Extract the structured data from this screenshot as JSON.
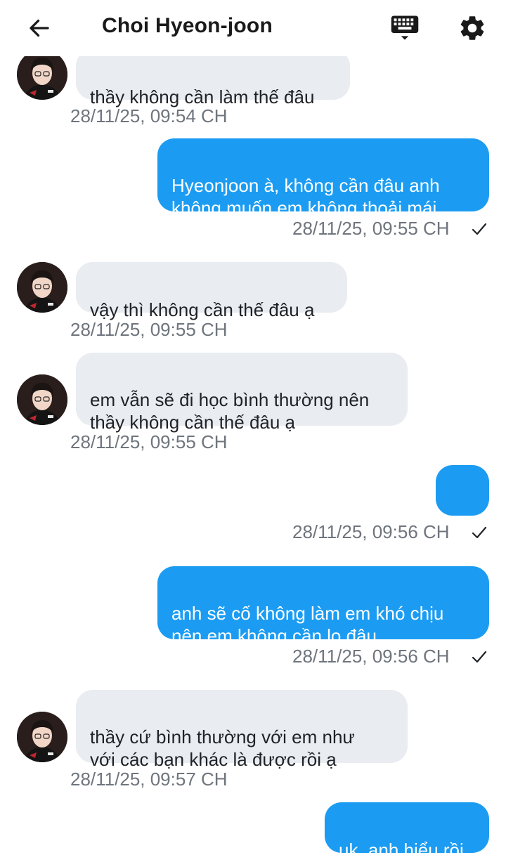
{
  "header": {
    "title": "Choi Hyeon-joon",
    "back_icon": "arrow-left-icon",
    "keyboard_icon": "keyboard-icon",
    "settings_icon": "gear-icon"
  },
  "colors": {
    "outgoing_bubble": "#1b9cf2",
    "incoming_bubble": "#e9ecf0",
    "timestamp": "#6f757d"
  },
  "messages": [
    {
      "direction": "incoming",
      "text": "thầy không cần làm thế đâu",
      "time": "28/11/25, 09:54 CH"
    },
    {
      "direction": "outgoing",
      "text": "Hyeonjoon à, không cần đâu anh\nkhông muốn em không thoải mái",
      "time": "28/11/25, 09:55 CH",
      "status_icon": "checkmark-icon"
    },
    {
      "direction": "incoming",
      "text": "vậy thì không cần thế đâu ạ",
      "time": "28/11/25, 09:55 CH"
    },
    {
      "direction": "incoming",
      "text": "em vẫn sẽ đi học bình thường nên\nthầy không cần thế đâu ạ",
      "time": "28/11/25, 09:55 CH"
    },
    {
      "direction": "outgoing",
      "text": "....",
      "time": "28/11/25, 09:56 CH",
      "status_icon": "checkmark-icon"
    },
    {
      "direction": "outgoing",
      "text": "anh sẽ cố không làm em khó chịu\nnên em không cần lo đâu",
      "time": "28/11/25, 09:56 CH",
      "status_icon": "checkmark-icon"
    },
    {
      "direction": "incoming",
      "text": "thầy cứ bình thường với em như\nvới các bạn khác là được rồi ạ",
      "time": "28/11/25, 09:57 CH"
    },
    {
      "direction": "outgoing",
      "text": "uk, anh hiểu rồi"
    }
  ]
}
